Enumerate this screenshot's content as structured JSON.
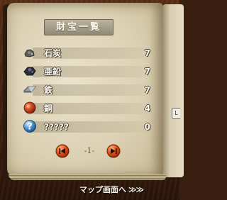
{
  "title": "財宝一覧",
  "items": [
    {
      "name": "石炭",
      "qty": "7",
      "icon": "coal-icon"
    },
    {
      "name": "亜鉛",
      "qty": "7",
      "icon": "zinc-ore-icon"
    },
    {
      "name": "鉄",
      "qty": "7",
      "icon": "iron-ingot-icon"
    },
    {
      "name": "銅",
      "qty": "4",
      "icon": "copper-orb-icon"
    },
    {
      "name": "?????",
      "qty": "0",
      "icon": "unknown-question-icon"
    }
  ],
  "pagination": {
    "page_label": "-1-",
    "prev_icon": "prev-arrow-icon",
    "next_icon": "next-arrow-icon"
  },
  "footer": {
    "map_label": "マップ画面へ",
    "arrows": "≫≫"
  },
  "side_tab_label": "L",
  "colors": {
    "nav_button": "#e0541c",
    "title_plate": "#a39d88",
    "frame": "#4a2410"
  }
}
